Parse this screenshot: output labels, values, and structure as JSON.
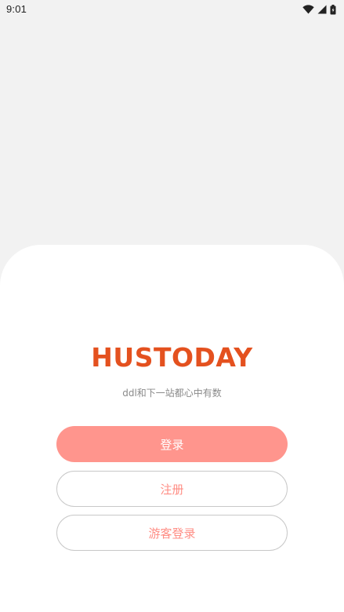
{
  "status_bar": {
    "time": "9:01",
    "icons": [
      "wifi-icon",
      "signal-icon",
      "battery-icon"
    ]
  },
  "app": {
    "title": "HUSTODAY",
    "tagline": "ddl和下一站都心中有数"
  },
  "buttons": {
    "login": "登录",
    "register": "注册",
    "guest_login": "游客登录"
  },
  "colors": {
    "brand": "#e4511f",
    "primary_button": "#ff958d",
    "secondary_text": "#ff8d84",
    "background": "#f2f2f2"
  }
}
